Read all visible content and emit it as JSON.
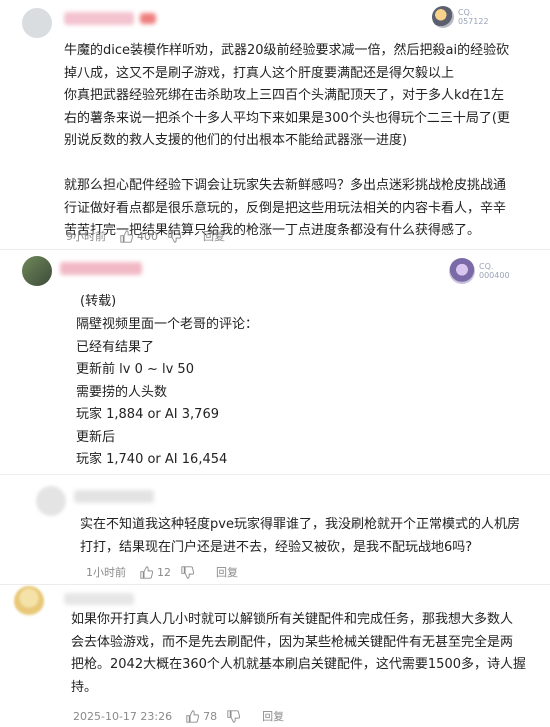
{
  "comments": [
    {
      "badge": {
        "line1": "CQ.",
        "line2": "057122"
      },
      "lines": [
        "牛魔的dice装模作样听劝，武器20级前经验要求减一倍，然后把殺ai的经验砍",
        "掉八成，这又不是刷子游戏，打真人这个肝度要满配还是得欠毅以上",
        "你真把武器经验死绑在击杀助攻上三四百个头满配顶天了，对于多人kd在1左",
        "右的薯条来说一把杀个十多人平均下来如果是300个头也得玩个二三十局了(更",
        "别说反数的救人支援的他们的付出根本不能给武器涨一进度)",
        "",
        "就那么担心配件经验下调会让玩家失去新鲜感吗？多出点迷彩挑战枪皮挑战通",
        "行证做好看点都是很乐意玩的，反倒是把这些用玩法相关的内容卡看人，辛辛",
        "苦苦打完一把结果结算只给我的枪涨一丁点进度条都没有什么获得感了。"
      ],
      "time": "9小时前",
      "likes": "400",
      "reply": "回复"
    },
    {
      "badge": {
        "line1": "CQ.",
        "line2": "000400"
      },
      "lines": [
        "(转载)",
        "隔壁视频里面一个老哥的评论：",
        "已经有结果了",
        "更新前 lv 0 ~ lv 50",
        "需要捞的人头数",
        "玩家 1,884 or AI 3,769",
        "更新后",
        "玩家 1,740 or AI 16,454"
      ]
    },
    {
      "lines": [
        "实在不知道我这种轻度pve玩家得罪谁了，我没刷枪就开个正常模式的人机房",
        "打打，结果现在门户还是进不去，经验又被砍，是我不配玩战地6吗?"
      ],
      "time": "1小时前",
      "likes": "12",
      "reply": "回复"
    },
    {
      "lines": [
        "如果你开打真人几小时就可以解锁所有关键配件和完成任务，那我想大多数人",
        "会去体验游戏，而不是先去刷配件，因为某些枪械关键配件有无甚至完全是两",
        "把枪。2042大概在360个人机就基本刷启关键配件，这代需要1500多，诗人握",
        "持。"
      ],
      "time": "2025-10-17 23:26",
      "likes": "78",
      "reply": "回复"
    }
  ]
}
